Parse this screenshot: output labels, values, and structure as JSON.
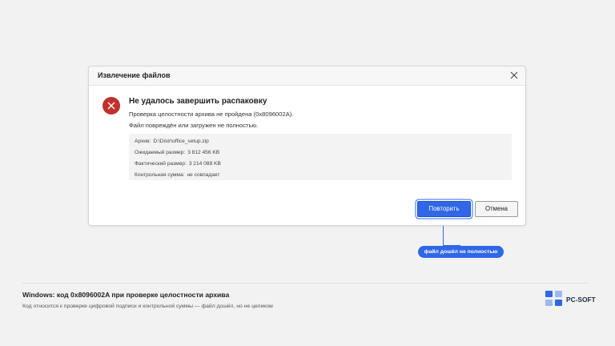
{
  "dialog": {
    "title": "Извлечение файлов",
    "headline": "Не удалось завершить распаковку",
    "message_line1": "Проверка целостности архива не пройдена (0x8096002A).",
    "message_line2": "Файл повреждён или загружен не полностью.",
    "details": [
      {
        "label": "Архив:",
        "value": "D:\\Distr\\office_setup.zip"
      },
      {
        "label": "Ожидаемый размер:",
        "value": "3 812 456 KB"
      },
      {
        "label": "Фактический размер:",
        "value": "3 214 088 KB"
      },
      {
        "label": "Контрольная сумма:",
        "value": "не совпадает"
      }
    ],
    "buttons": {
      "retry": "Повторить",
      "cancel": "Отмена"
    }
  },
  "callout": {
    "text": "файл дошёл не полностью"
  },
  "footer": {
    "title": "Windows: код 0x8096002A при проверке целостности архива",
    "subtitle": "Код относится к проверке цифровой подписи и контрольной суммы — файл дошёл, но не целиком"
  },
  "brand": {
    "name": "PC-SOFT"
  },
  "colors": {
    "accent": "#2f67e6",
    "error": "#c0312b",
    "background": "#f2f2f2"
  },
  "icons": [
    "close-icon",
    "error-icon",
    "pc-soft-logo-icon"
  ]
}
